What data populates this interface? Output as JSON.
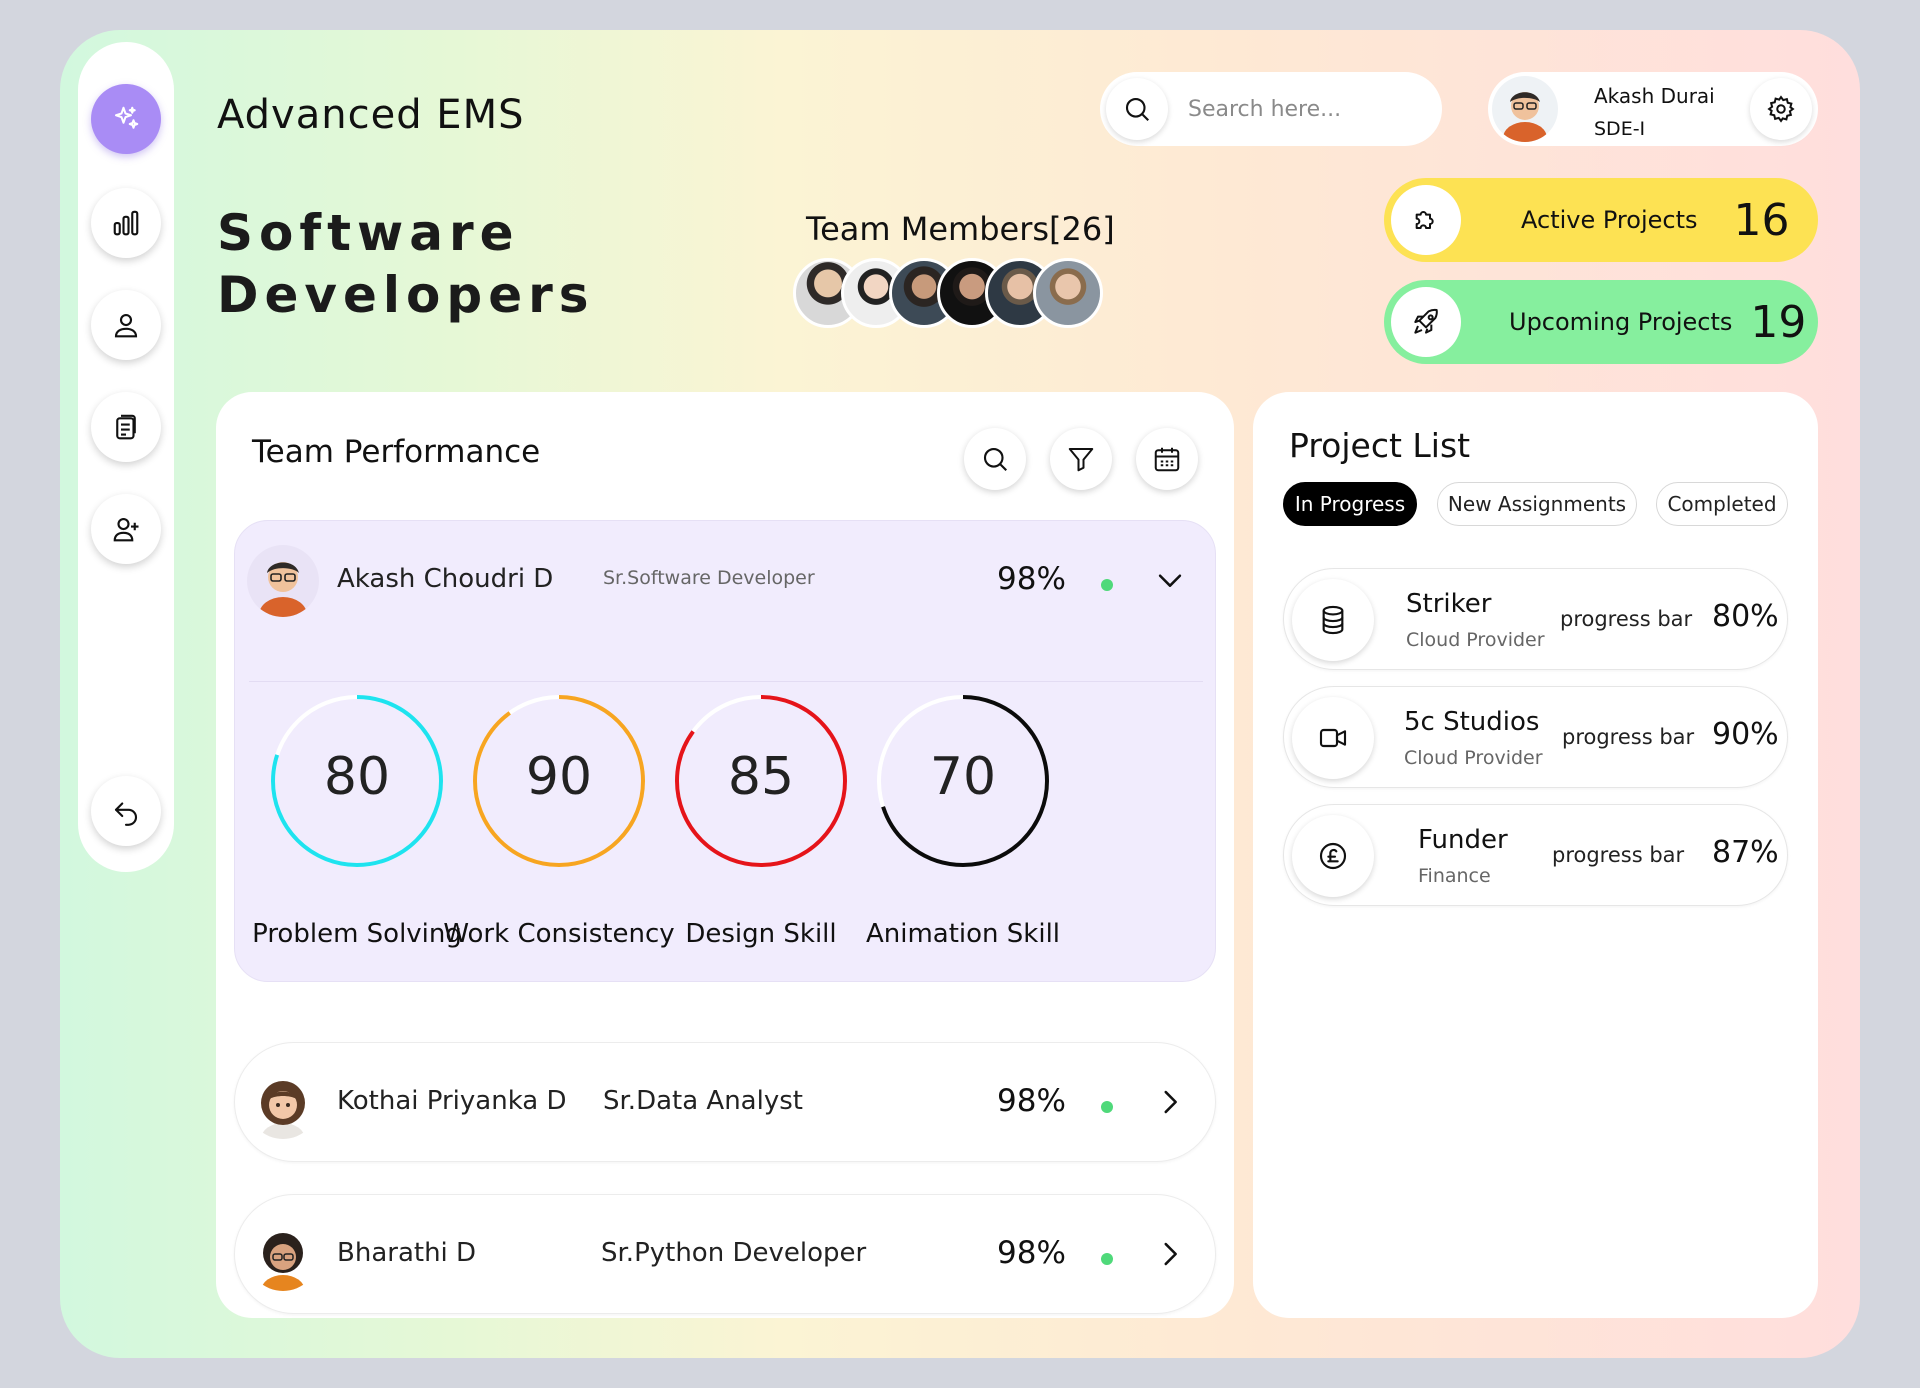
{
  "app": {
    "title": "Advanced EMS"
  },
  "headline": {
    "line1": "Software",
    "line2": "Developers"
  },
  "team": {
    "title": "Team Members[26]",
    "avatar_count": 6
  },
  "search": {
    "placeholder": "Search here..."
  },
  "user": {
    "name": "Akash Durai",
    "role": "SDE-I"
  },
  "stats": {
    "active": {
      "label": "Active Projects",
      "value": "16"
    },
    "upcoming": {
      "label": "Upcoming Projects",
      "value": "19"
    }
  },
  "sidebar": {
    "icons": [
      "sparkles-icon",
      "bar-chart-icon",
      "user-icon",
      "clipboard-icon",
      "user-plus-icon",
      "undo-icon"
    ]
  },
  "performance": {
    "title": "Team Performance",
    "members": [
      {
        "name": "Akash Choudri D",
        "role": "Sr.Software Developer",
        "percent": "98%",
        "expanded": true,
        "metrics": [
          {
            "label": "Problem Solving",
            "value": 80,
            "display": "80",
            "color": "#1ee3ef"
          },
          {
            "label": "Work Consistency",
            "value": 90,
            "display": "90",
            "color": "#f7a521"
          },
          {
            "label": "Design Skill",
            "value": 85,
            "display": "85",
            "color": "#e5141a"
          },
          {
            "label": "Animation Skill",
            "value": 70,
            "display": "70",
            "color": "#0b0b0b"
          }
        ]
      },
      {
        "name": "Kothai Priyanka D",
        "role": "Sr.Data Analyst",
        "percent": "98%",
        "expanded": false
      },
      {
        "name": "Bharathi D",
        "role": "Sr.Python Developer",
        "percent": "98%",
        "expanded": false
      }
    ]
  },
  "projects": {
    "title": "Project List",
    "tabs": [
      "In Progress",
      "New Assignments",
      "Completed"
    ],
    "active_tab": "In Progress",
    "items": [
      {
        "name": "Striker",
        "category": "Cloud Provider",
        "bar_label": "progress bar",
        "percent": "80%",
        "icon": "database-icon"
      },
      {
        "name": "5c Studios",
        "category": "Cloud Provider",
        "bar_label": "progress bar",
        "percent": "90%",
        "icon": "video-icon"
      },
      {
        "name": "Funder",
        "category": "Finance",
        "bar_label": "progress bar",
        "percent": "87%",
        "icon": "pound-coin-icon"
      }
    ]
  }
}
